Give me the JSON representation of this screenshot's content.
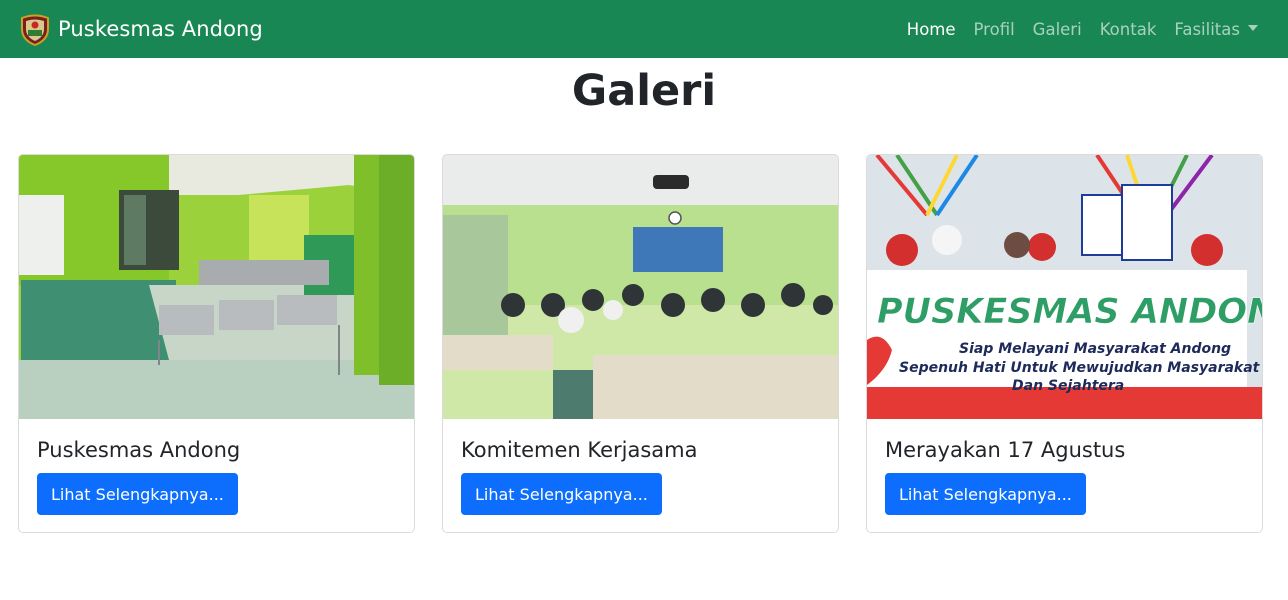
{
  "navbar": {
    "brand": "Puskesmas Andong",
    "logo_icon": "regency-shield-logo-icon",
    "links": [
      {
        "label": "Home",
        "active": true
      },
      {
        "label": "Profil",
        "active": false
      },
      {
        "label": "Galeri",
        "active": false
      },
      {
        "label": "Kontak",
        "active": false
      },
      {
        "label": "Fasilitas",
        "active": false,
        "dropdown": true
      }
    ]
  },
  "page": {
    "title": "Galeri"
  },
  "gallery": [
    {
      "title": "Puskesmas Andong",
      "button": "Lihat Selengkapnya...",
      "photo": "green-waiting-room-with-metal-benches"
    },
    {
      "title": "Komitemen Kerjasama",
      "button": "Lihat Selengkapnya...",
      "photo": "meeting-room-audience-with-projector"
    },
    {
      "title": "Merayakan 17 Agustus",
      "button": "Lihat Selengkapnya...",
      "photo": "parade-with-puskesmas-andong-banner"
    }
  ],
  "banner_photo": {
    "line1": "PUSKESMAS ANDONG",
    "line2": "Siap Melayani Masyarakat Andong",
    "line3": "Sepenuh Hati Untuk Mewujudkan Masyarakat S",
    "line4": "Dan Sejahtera"
  },
  "colors": {
    "navbar": "#198754",
    "button": "#0d6efd",
    "text": "#212529"
  }
}
